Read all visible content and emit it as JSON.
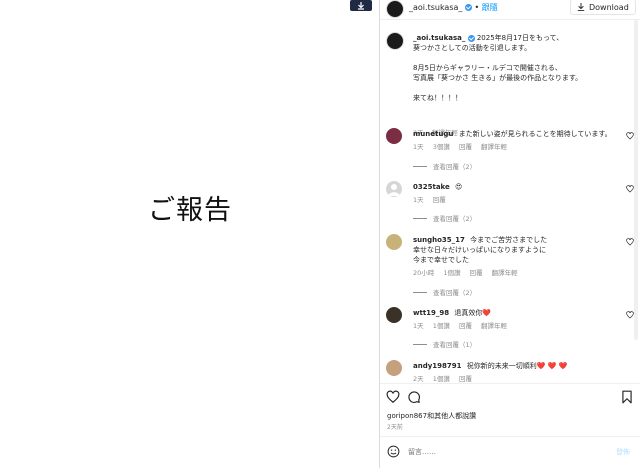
{
  "post_image": {
    "text": "ご報告"
  },
  "header": {
    "username": "_aoi.tsukasa_",
    "separator": "•",
    "follow_label": "跟隨",
    "download_label": "Download"
  },
  "caption": {
    "username": "_aoi.tsukasa_",
    "lines": [
      "2025年8月17日をもって、",
      "葵つかさとしての活動を引退します。",
      "",
      "8月5日からギャラリー・ルデコで開催される、",
      "写真展「葵つかさ 生きる」が最後の作品となります。",
      "",
      "来てね！！！！"
    ],
    "time": "2天",
    "translate": "翻譯年輕"
  },
  "comments": [
    {
      "username": "munetugu",
      "text": "また新しい姿が見られることを期待しています。",
      "time": "1天",
      "likes": "3個讚",
      "reply": "回覆",
      "translate": "翻譯年輕",
      "view_replies": "查看回覆（2）"
    },
    {
      "username": "0325take",
      "text": "😍",
      "time": "1天",
      "reply": "回覆",
      "view_replies": "查看回覆（2）"
    },
    {
      "username": "sungho35_17",
      "text_lines": [
        "今までご苦労さまでした",
        "幸せな日々だけいっぱいになりますように",
        "今まで幸せでした"
      ],
      "time": "20小時",
      "likes": "1個讚",
      "reply": "回覆",
      "translate": "翻譯年輕",
      "view_replies": "查看回覆（2）"
    },
    {
      "username": "wtt19_98",
      "text": "退真效你❤️",
      "time": "1天",
      "likes": "1個讚",
      "reply": "回覆",
      "translate": "翻譯年輕",
      "view_replies": "查看回覆（1）"
    },
    {
      "username": "andy198791",
      "text": "祝你新的未来一切順利❤️ ❤️ ❤️",
      "time": "2天",
      "likes": "1個讚",
      "reply": "回覆"
    }
  ],
  "likes_line": "goripon867和其他人都說讚",
  "post_time": "2天前",
  "comment_box": {
    "placeholder": "留言……",
    "post_label": "發佈"
  },
  "colors": {
    "verified": "#3897f0",
    "follow": "#0095f6",
    "heart": "#ed4956"
  }
}
